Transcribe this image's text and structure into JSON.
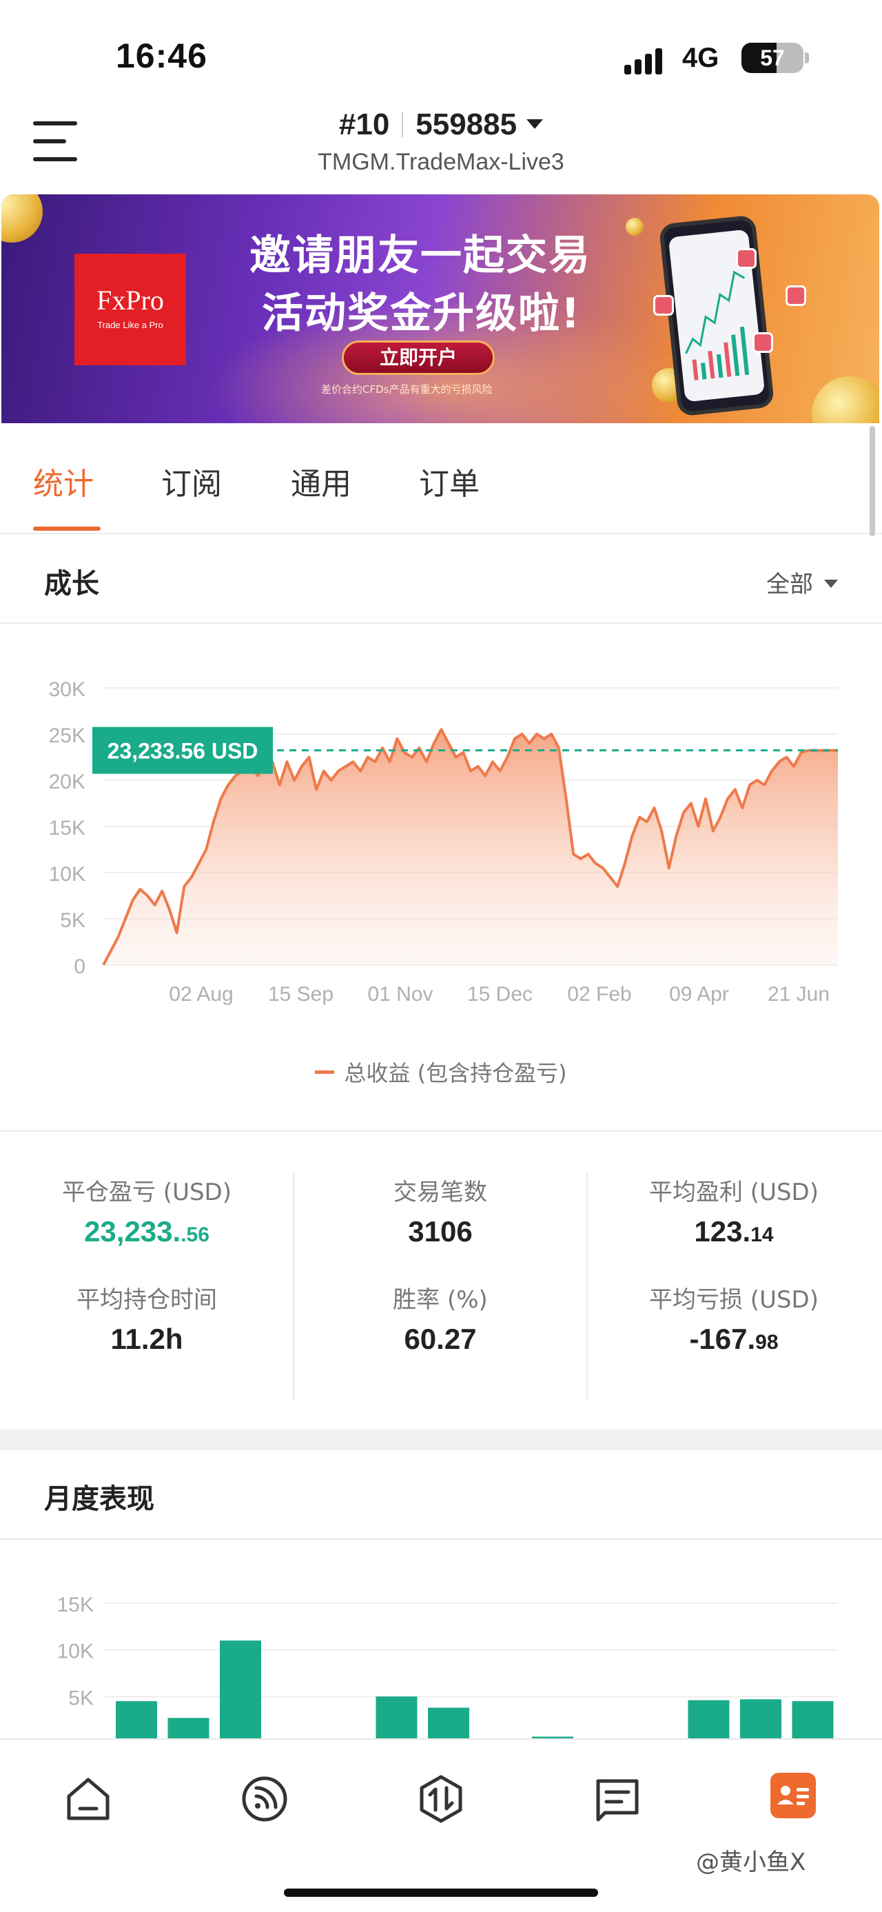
{
  "status_bar": {
    "time": "16:46",
    "network": "4G",
    "battery": "57",
    "battery_level": 0.57
  },
  "header": {
    "account_number": "#10",
    "account_id": "559885",
    "server": "TMGM.TradeMax-Live3"
  },
  "banner": {
    "logo": "FxPro",
    "logo_tagline": "Trade Like a Pro",
    "line1": "邀请朋友一起交易",
    "line2": "活动奖金升级啦!",
    "cta": "立即开户",
    "disclaimer": "差价合约CFDs产品有重大的亏损风险"
  },
  "tabs": [
    {
      "label": "统计",
      "active": true
    },
    {
      "label": "订阅",
      "active": false
    },
    {
      "label": "通用",
      "active": false
    },
    {
      "label": "订单",
      "active": false
    }
  ],
  "growth": {
    "title": "成长",
    "filter": "全部",
    "tooltip": "23,233.56 USD",
    "legend": "总收益 (包含持仓盈亏)"
  },
  "chart_data": [
    {
      "type": "area",
      "y_ticks": [
        "30K",
        "25K",
        "20K",
        "15K",
        "10K",
        "5K",
        "0"
      ],
      "x_ticks": [
        "02 Aug",
        "15 Sep",
        "01 Nov",
        "15 Dec",
        "02 Feb",
        "09 Apr",
        "21 Jun"
      ],
      "ylim": [
        0,
        30000
      ],
      "reference_value": 23233.56,
      "series": [
        {
          "name": "总收益 (包含持仓盈亏)",
          "color": "#ee7a4c",
          "x": [
            0,
            1,
            2,
            3,
            4,
            5,
            6,
            7,
            8,
            9,
            10,
            11,
            12,
            13,
            14,
            15,
            16,
            17,
            18,
            19,
            20,
            21,
            22,
            23,
            24,
            25,
            26,
            27,
            28,
            29,
            30,
            31,
            32,
            33,
            34,
            35,
            36,
            37,
            38,
            39,
            40,
            41,
            42,
            43,
            44,
            45,
            46,
            47,
            48,
            49,
            50,
            51,
            52,
            53,
            54,
            55,
            56,
            57,
            58,
            59,
            60,
            61,
            62,
            63,
            64,
            65,
            66,
            67,
            68,
            69,
            70,
            71,
            72,
            73,
            74,
            75,
            76,
            77,
            78,
            79,
            80,
            81,
            82,
            83,
            84,
            85,
            86,
            87,
            88,
            89,
            90,
            91,
            92,
            93,
            94,
            95,
            96,
            97,
            98,
            99,
            100
          ],
          "y": [
            0,
            1500,
            3000,
            5000,
            7000,
            8200,
            7500,
            6500,
            8000,
            6000,
            3500,
            8500,
            9500,
            11000,
            12500,
            15500,
            18000,
            19500,
            20500,
            21000,
            22000,
            20500,
            21500,
            22000,
            19500,
            22000,
            20000,
            21500,
            22500,
            19000,
            21000,
            20000,
            21000,
            21500,
            22000,
            21000,
            22500,
            22000,
            23500,
            22000,
            24500,
            23000,
            22500,
            23500,
            22000,
            24000,
            25500,
            24000,
            22500,
            23000,
            21000,
            21500,
            20500,
            22000,
            21000,
            22500,
            24500,
            25000,
            24000,
            25000,
            24500,
            25000,
            23500,
            18000,
            12000,
            11500,
            12000,
            11000,
            10500,
            9500,
            8500,
            11000,
            14000,
            16000,
            15500,
            17000,
            14500,
            10500,
            14000,
            16500,
            17500,
            15000,
            18000,
            14500,
            16000,
            18000,
            19000,
            17000,
            19500,
            20000,
            19500,
            21000,
            22000,
            22500,
            21500,
            23000,
            23233.56,
            23233.56,
            23233.56,
            23233.56,
            23233.56
          ]
        }
      ]
    },
    {
      "type": "bar",
      "y_ticks": [
        "15K",
        "10K",
        "5K"
      ],
      "ylim": [
        0,
        15000
      ],
      "color": "#1aab8a",
      "values": [
        4500,
        2700,
        11000,
        0,
        0,
        5000,
        3800,
        0,
        700,
        0,
        0,
        4600,
        4700,
        4500
      ]
    }
  ],
  "stats": [
    {
      "label": "平仓盈亏 (USD)",
      "value_main": "23,233.",
      "value_small": ".56",
      "color": "#1aab8a"
    },
    {
      "label": "交易笔数",
      "value_main": "3106",
      "value_small": ""
    },
    {
      "label": "平均盈利 (USD)",
      "value_main": "123.",
      "value_small": "14"
    },
    {
      "label": "平均持仓时间",
      "value_main": "11.2h",
      "value_small": ""
    },
    {
      "label": "胜率 (%)",
      "value_main": "60.27",
      "value_small": ""
    },
    {
      "label": "平均亏损 (USD)",
      "value_main": "-167.",
      "value_small": "98"
    }
  ],
  "monthly": {
    "title": "月度表现"
  },
  "bottom_nav": [
    {
      "icon": "home-icon"
    },
    {
      "icon": "signal-feed-icon"
    },
    {
      "icon": "trade-icon"
    },
    {
      "icon": "news-icon"
    },
    {
      "icon": "account-card-icon",
      "active": true
    }
  ],
  "watermark": "@黄小鱼X"
}
